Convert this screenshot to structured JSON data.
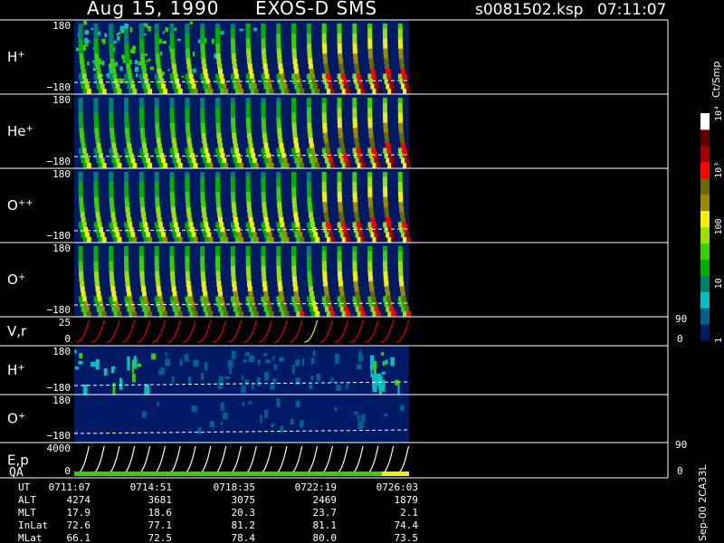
{
  "header": {
    "date": "Aug 15, 1990",
    "instrument": "EXOS-D SMS",
    "file": "s0081502.ksp",
    "time": "07:11:07"
  },
  "colorbar": {
    "title": "Ct/Smp",
    "tick_labels": [
      "1",
      "10",
      "100",
      "10³",
      "10⁴"
    ],
    "tick_values": [
      1,
      10,
      100,
      1000,
      10000
    ],
    "colors": [
      "#001a66",
      "#00608f",
      "#00c0c0",
      "#007f6a",
      "#00b000",
      "#3ad000",
      "#9ae000",
      "#f0f000",
      "#9a8a00",
      "#6a6a00",
      "#ff0000",
      "#a00000",
      "#600000",
      "#ffffff"
    ]
  },
  "footer": {
    "side_label": "Sep-00 2CA33L",
    "row_labels": [
      "UT",
      "ALT",
      "MLT",
      "InLat",
      "MLat"
    ],
    "columns": [
      {
        "UT": "0711:07",
        "ALT": "4274",
        "MLT": "17.9",
        "InLat": "72.6",
        "MLat": "66.1"
      },
      {
        "UT": "0714:51",
        "ALT": "3681",
        "MLT": "18.6",
        "InLat": "77.1",
        "MLat": "72.5"
      },
      {
        "UT": "0718:35",
        "ALT": "3075",
        "MLT": "20.3",
        "InLat": "81.2",
        "MLat": "78.4"
      },
      {
        "UT": "0722:19",
        "ALT": "2469",
        "MLT": "23.7",
        "InLat": "81.1",
        "MLat": "80.0"
      },
      {
        "UT": "0726:03",
        "ALT": "1879",
        "MLT": "2.1",
        "InLat": "74.4",
        "MLat": "73.5"
      }
    ]
  },
  "chart_data": {
    "type": "heatmap",
    "x_type": "time",
    "x_range": [
      "0711:07",
      "0729:00"
    ],
    "data_end": "0728:05",
    "panels": [
      {
        "id": "h-plus-1",
        "label": "H",
        "sup": "+",
        "ytop": "180",
        "ybot": "−180",
        "kind": "spectro",
        "spins": 22,
        "bg": "#001a66",
        "intensity": [
          0.55,
          0.55,
          0.52,
          0.5,
          0.55,
          0.58,
          0.6,
          0.62,
          0.65,
          0.66,
          0.68,
          0.7,
          0.7,
          0.72,
          0.74,
          0.76,
          0.9,
          0.92,
          0.9,
          0.94,
          0.96,
          0.95
        ],
        "noise": [
          1,
          1,
          1,
          0.8,
          0.7,
          0.5,
          0.4,
          0.3,
          0.2,
          0.2,
          0.1,
          0.1,
          0,
          0,
          0,
          0,
          0,
          0,
          0,
          0,
          0,
          0
        ]
      },
      {
        "id": "he-plus",
        "label": "He",
        "sup": "+",
        "ytop": "180",
        "ybot": "−180",
        "kind": "spectro",
        "spins": 22,
        "bg": "#001a66",
        "intensity": [
          0.55,
          0.56,
          0.56,
          0.57,
          0.58,
          0.6,
          0.6,
          0.6,
          0.62,
          0.62,
          0.63,
          0.64,
          0.65,
          0.66,
          0.7,
          0.72,
          0.85,
          0.88,
          0.9,
          0.92,
          0.94,
          0.95
        ],
        "noise": [
          0,
          0,
          0,
          0,
          0,
          0,
          0,
          0,
          0,
          0,
          0,
          0,
          0,
          0,
          0,
          0,
          0,
          0,
          0,
          0,
          0,
          0
        ]
      },
      {
        "id": "o-plus-plus",
        "label": "O",
        "sup": "++",
        "ytop": "180",
        "ybot": "−180",
        "kind": "spectro",
        "spins": 22,
        "bg": "#001a66",
        "intensity": [
          0.6,
          0.6,
          0.6,
          0.62,
          0.62,
          0.62,
          0.63,
          0.64,
          0.64,
          0.65,
          0.66,
          0.66,
          0.66,
          0.68,
          0.7,
          0.6,
          0.9,
          0.92,
          0.92,
          0.94,
          0.95,
          0.9
        ],
        "noise": [
          0,
          0,
          0,
          0,
          0,
          0,
          0,
          0,
          0,
          0,
          0,
          0,
          0,
          0,
          0,
          0,
          0,
          0,
          0,
          0,
          0,
          0
        ]
      },
      {
        "id": "o-plus-1",
        "label": "O",
        "sup": "+",
        "ytop": "180",
        "ybot": "−180",
        "kind": "spectro",
        "spins": 22,
        "bg": "#001a66",
        "intensity": [
          0.7,
          0.7,
          0.7,
          0.72,
          0.72,
          0.72,
          0.72,
          0.74,
          0.74,
          0.74,
          0.75,
          0.76,
          0.76,
          0.76,
          0.78,
          0.6,
          0.82,
          0.82,
          0.84,
          0.84,
          0.82,
          0.8
        ],
        "noise": [
          0,
          0,
          0,
          0,
          0,
          0,
          0,
          0,
          0,
          0,
          0,
          0,
          0,
          0,
          0,
          0,
          0,
          0,
          0,
          0,
          0,
          0
        ]
      },
      {
        "id": "v-r",
        "label": "V,r",
        "sup": "",
        "ytop": "25",
        "ybot": "0",
        "right_top": "90",
        "right_bot": "0",
        "kind": "line",
        "spins": 22,
        "color": "#e00000"
      },
      {
        "id": "h-plus-2",
        "label": "H",
        "sup": "+",
        "ytop": "180",
        "ybot": "−180",
        "kind": "sparse",
        "bg": "#001a66"
      },
      {
        "id": "o-plus-2",
        "label": "O",
        "sup": "+",
        "ytop": "180",
        "ybot": "−180",
        "kind": "sparse",
        "bg": "#001a66"
      },
      {
        "id": "e-p",
        "label": "E,p",
        "sup": "",
        "ytop": "4000",
        "ybot": "0",
        "right_top": "90",
        "right_bot": "0",
        "kind": "line",
        "spins": 22,
        "color": "#ffffff",
        "qa_label": "QA"
      }
    ]
  }
}
